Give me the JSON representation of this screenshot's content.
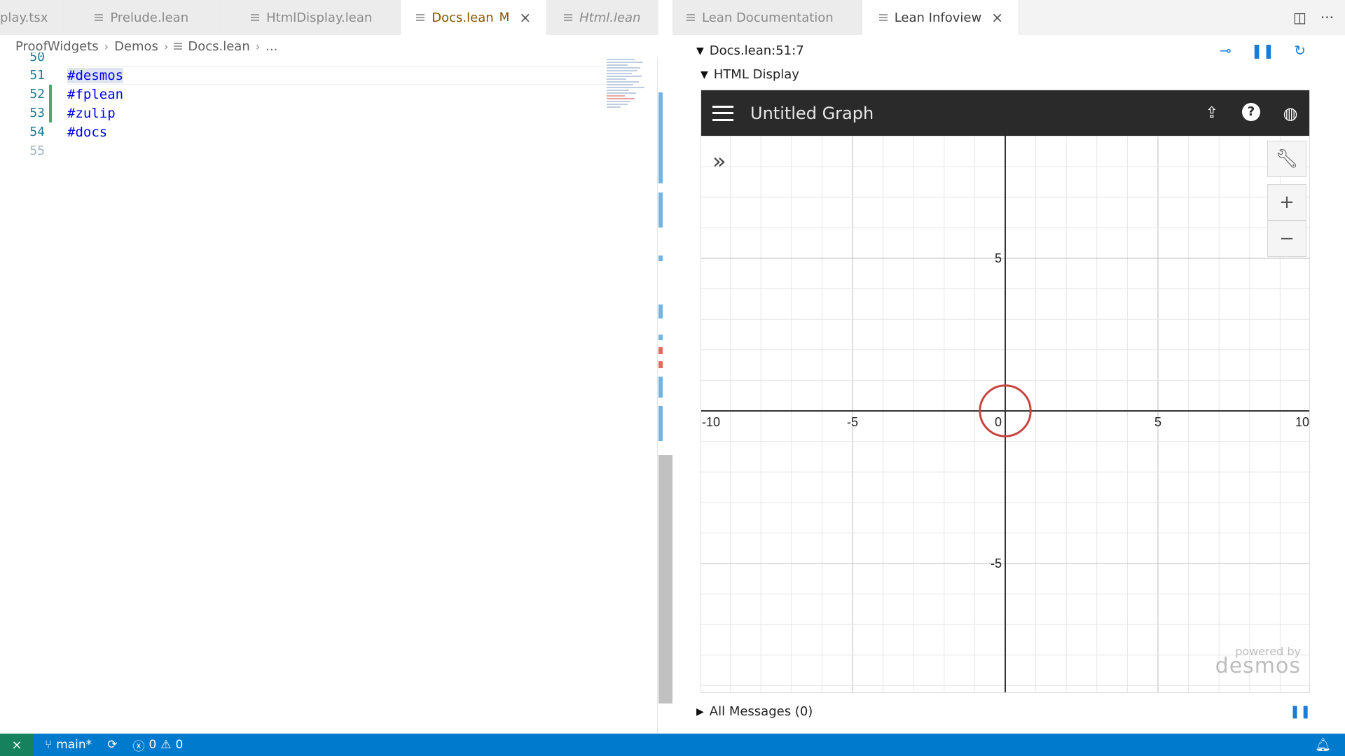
{
  "editor_tabs": [
    {
      "label": "play.tsx"
    },
    {
      "label": "Prelude.lean"
    },
    {
      "label": "HtmlDisplay.lean"
    },
    {
      "label": "Docs.lean",
      "modified_flag": "M"
    },
    {
      "label": "Html.lean"
    }
  ],
  "editor_more": "···",
  "infoview_tabs": [
    {
      "label": "Lean Documentation"
    },
    {
      "label": "Lean Infoview",
      "close": "×"
    }
  ],
  "breadcrumb": [
    "ProofWidgets",
    "Demos",
    "Docs.lean",
    "..."
  ],
  "code_lines": [
    {
      "num": "51",
      "text": "#desmos"
    },
    {
      "num": "52",
      "text": "#fplean"
    },
    {
      "num": "53",
      "text": "#zulip"
    },
    {
      "num": "54",
      "text": "#docs"
    },
    {
      "num": "55",
      "text": ""
    }
  ],
  "infoview": {
    "position": "Docs.lean:51:7",
    "html_display": "HTML Display",
    "all_messages": "All Messages (0)"
  },
  "desmos": {
    "title": "Untitled Graph",
    "powered_by": "powered by",
    "brand": "desmos",
    "tools": [
      "wrench-icon",
      "zoom-in",
      "zoom-out"
    ],
    "curve_color": "#c74440"
  },
  "chart_data": {
    "type": "scatter",
    "title": "Untitled Graph",
    "xlim": [
      -10,
      10
    ],
    "ylim": [
      -9,
      9
    ],
    "x_ticks": [
      -10,
      -5,
      0,
      5,
      10
    ],
    "y_ticks": [
      5,
      -5
    ],
    "grid": true,
    "series": [
      {
        "shape": "circle",
        "center": [
          0,
          0
        ],
        "radius": 1,
        "color": "#c74440"
      }
    ]
  },
  "statusbar": {
    "branch": "main*",
    "errors": "0",
    "warnings": "0"
  }
}
